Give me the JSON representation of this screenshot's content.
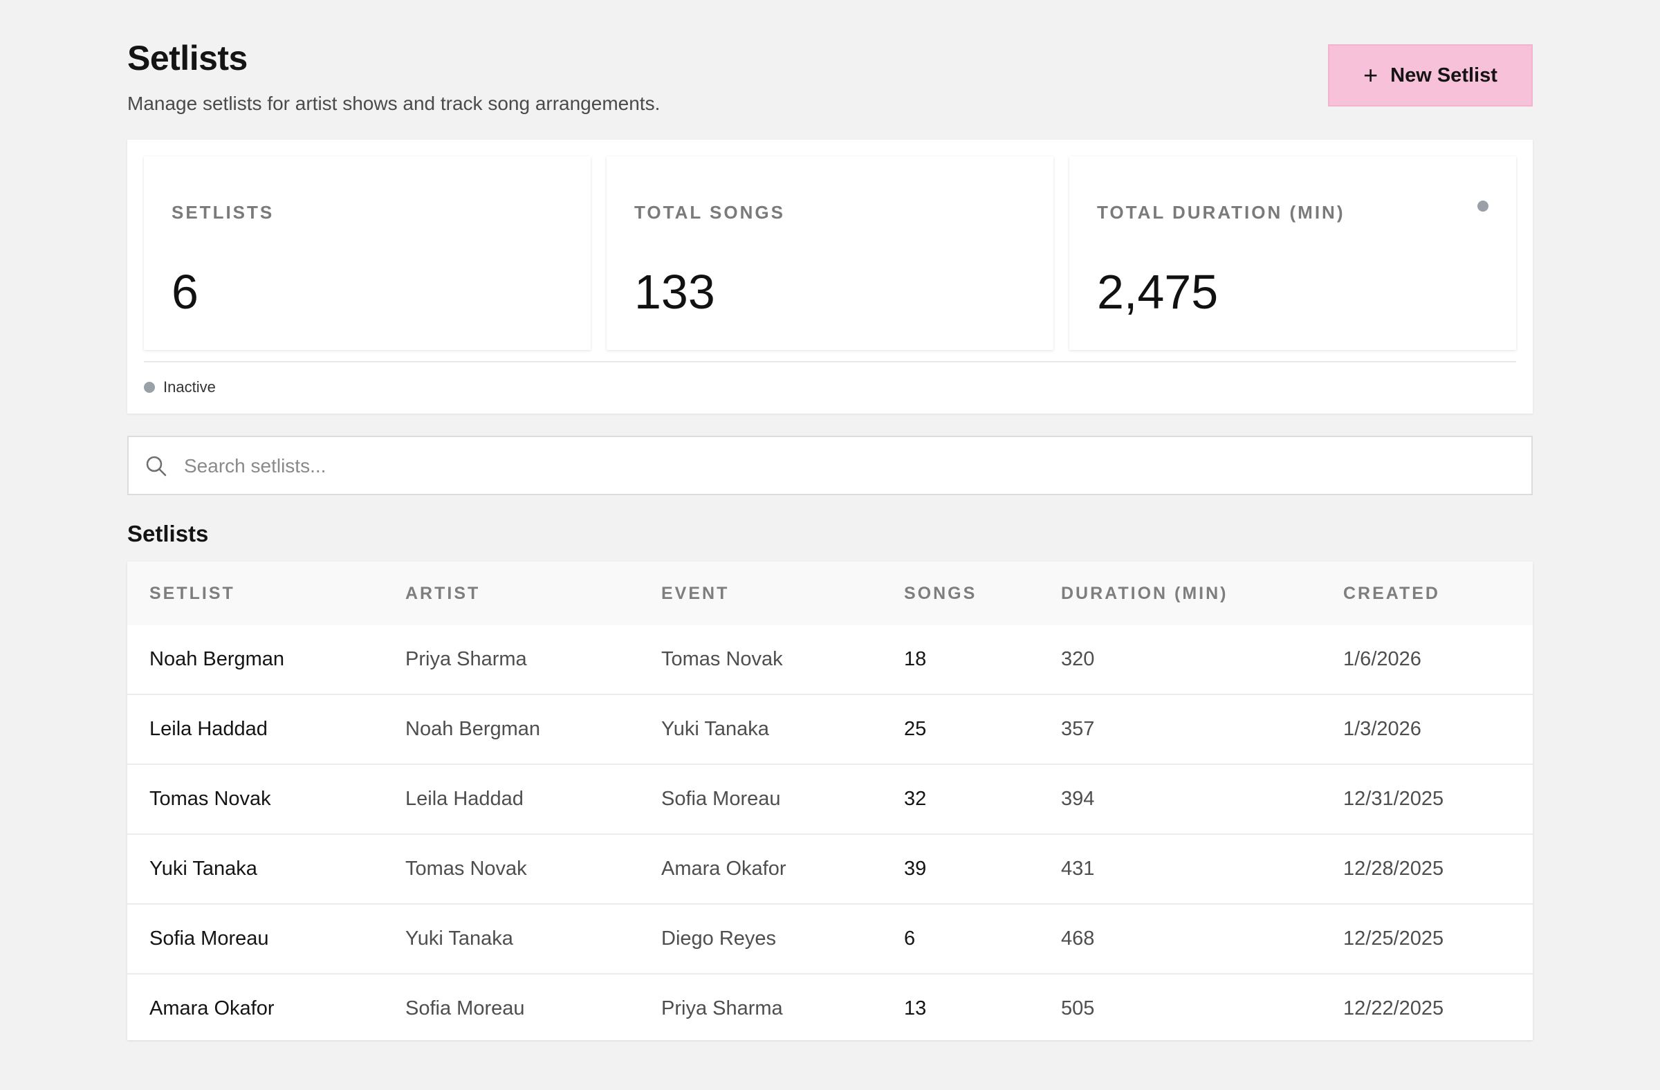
{
  "header": {
    "title": "Setlists",
    "subtitle": "Manage setlists for artist shows and track song arrangements.",
    "new_button_label": "New Setlist",
    "new_button_icon": "plus-icon"
  },
  "stats": [
    {
      "label": "SETLISTS",
      "value": "6"
    },
    {
      "label": "TOTAL SONGS",
      "value": "133"
    },
    {
      "label": "TOTAL DURATION (MIN)",
      "value": "2,475"
    }
  ],
  "legend": {
    "label": "Inactive",
    "color": "#9aa0a8"
  },
  "search": {
    "placeholder": "Search setlists...",
    "icon": "search-icon"
  },
  "table": {
    "title": "Setlists",
    "columns": [
      "SETLIST",
      "ARTIST",
      "EVENT",
      "SONGS",
      "DURATION (MIN)",
      "CREATED"
    ],
    "rows": [
      [
        "Noah Bergman",
        "Priya Sharma",
        "Tomas Novak",
        "18",
        "320",
        "1/6/2026"
      ],
      [
        "Leila Haddad",
        "Noah Bergman",
        "Yuki Tanaka",
        "25",
        "357",
        "1/3/2026"
      ],
      [
        "Tomas Novak",
        "Leila Haddad",
        "Sofia Moreau",
        "32",
        "394",
        "12/31/2025"
      ],
      [
        "Yuki Tanaka",
        "Tomas Novak",
        "Amara Okafor",
        "39",
        "431",
        "12/28/2025"
      ],
      [
        "Sofia Moreau",
        "Yuki Tanaka",
        "Diego Reyes",
        "6",
        "468",
        "12/25/2025"
      ],
      [
        "Amara Okafor",
        "Sofia Moreau",
        "Priya Sharma",
        "13",
        "505",
        "12/22/2025"
      ]
    ]
  },
  "colors": {
    "accent": "#f7c1d9",
    "background": "#f2f2f2",
    "status_inactive": "#9aa0a8"
  }
}
